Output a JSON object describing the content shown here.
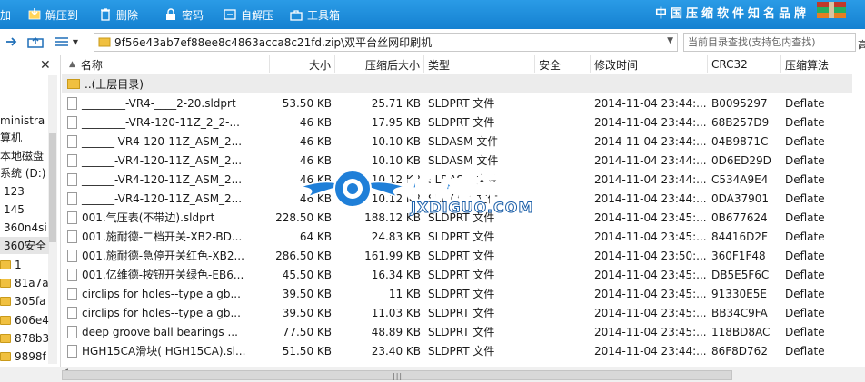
{
  "toolbar": {
    "items": [
      {
        "label": "加",
        "icon": "add-icon"
      },
      {
        "label": "解压到",
        "icon": "extract-to-icon"
      },
      {
        "label": "删除",
        "icon": "delete-icon"
      },
      {
        "label": "密码",
        "icon": "password-icon"
      },
      {
        "label": "自解压",
        "icon": "self-extract-icon"
      },
      {
        "label": "工具箱",
        "icon": "toolbox-icon"
      }
    ],
    "brand": "中国压缩软件知名品牌",
    "colors": {
      "background": "#1a8ad9",
      "text": "#ffffff"
    }
  },
  "address": {
    "path": "9f56e43ab7ef88ee8c4863acca8c21fd.zip\\双平台丝网印刷机",
    "search_placeholder": "当前目录查找(支持包内查找)",
    "search_button": "高"
  },
  "tree": {
    "items": [
      {
        "label": "ministra",
        "folder": false
      },
      {
        "label": "算机",
        "folder": false
      },
      {
        "label": "本地磁盘",
        "folder": false
      },
      {
        "label": "系统 (D:)",
        "folder": false
      },
      {
        "label": "123",
        "folder": false
      },
      {
        "label": "145",
        "folder": false
      },
      {
        "label": "360n4si",
        "folder": false
      },
      {
        "label": "360安全",
        "folder": false
      },
      {
        "label": "1",
        "folder": true
      },
      {
        "label": "81a7a",
        "folder": true
      },
      {
        "label": "305fa",
        "folder": true
      },
      {
        "label": "606e4",
        "folder": true
      },
      {
        "label": "878b3",
        "folder": true
      },
      {
        "label": "9898f",
        "folder": true
      }
    ]
  },
  "columns": [
    "名称",
    "大小",
    "压缩后大小",
    "类型",
    "安全",
    "修改时间",
    "CRC32",
    "压缩算法"
  ],
  "parent_row": {
    "label": "..(上层目录)"
  },
  "files": [
    {
      "name": "________-VR4-____2-20.sldprt",
      "size": "53.50 KB",
      "packed": "25.71 KB",
      "type": "SLDPRT 文件",
      "time": "2014-11-04 23:44:...",
      "crc": "B0095297",
      "method": "Deflate"
    },
    {
      "name": "________-VR4-120-11Z_2_2-...",
      "size": "46 KB",
      "packed": "17.95 KB",
      "type": "SLDPRT 文件",
      "time": "2014-11-04 23:44:...",
      "crc": "68B257D9",
      "method": "Deflate"
    },
    {
      "name": "______-VR4-120-11Z_ASM_2...",
      "size": "46 KB",
      "packed": "10.10 KB",
      "type": "SLDASM 文件",
      "time": "2014-11-04 23:44:...",
      "crc": "04B9871C",
      "method": "Deflate"
    },
    {
      "name": "______-VR4-120-11Z_ASM_2...",
      "size": "46 KB",
      "packed": "10.10 KB",
      "type": "SLDASM 文件",
      "time": "2014-11-04 23:44:...",
      "crc": "0D6ED29D",
      "method": "Deflate"
    },
    {
      "name": "______-VR4-120-11Z_ASM_2...",
      "size": "46 KB",
      "packed": "10.12 KB",
      "type": "SLDASM 文件",
      "time": "2014-11-04 23:44:...",
      "crc": "C534A9E4",
      "method": "Deflate"
    },
    {
      "name": "______-VR4-120-11Z_ASM_2...",
      "size": "46 KB",
      "packed": "10.12 KB",
      "type": "SLDASM 文件",
      "time": "2014-11-04 23:44:...",
      "crc": "0DA37901",
      "method": "Deflate"
    },
    {
      "name": "001.气压表(不带边).sldprt",
      "size": "228.50 KB",
      "packed": "188.12 KB",
      "type": "SLDPRT 文件",
      "time": "2014-11-04 23:45:...",
      "crc": "0B677624",
      "method": "Deflate"
    },
    {
      "name": "001.施耐德-二档开关-XB2-BD...",
      "size": "64 KB",
      "packed": "24.83 KB",
      "type": "SLDPRT 文件",
      "time": "2014-11-04 23:45:...",
      "crc": "84416D2F",
      "method": "Deflate"
    },
    {
      "name": "001.施耐德-急停开关红色-XB2...",
      "size": "286.50 KB",
      "packed": "161.99 KB",
      "type": "SLDPRT 文件",
      "time": "2014-11-04 23:50:...",
      "crc": "360F1F48",
      "method": "Deflate"
    },
    {
      "name": "001.亿维德-按钮开关绿色-EB6...",
      "size": "45.50 KB",
      "packed": "16.34 KB",
      "type": "SLDPRT 文件",
      "time": "2014-11-04 23:45:...",
      "crc": "DB5E5F6C",
      "method": "Deflate"
    },
    {
      "name": "circlips for holes--type a gb...",
      "size": "39.50 KB",
      "packed": "11 KB",
      "type": "SLDPRT 文件",
      "time": "2014-11-04 23:45:...",
      "crc": "91330E5E",
      "method": "Deflate"
    },
    {
      "name": "circlips for holes--type a gb...",
      "size": "39.50 KB",
      "packed": "11.03 KB",
      "type": "SLDPRT 文件",
      "time": "2014-11-04 23:45:...",
      "crc": "BB34C9FA",
      "method": "Deflate"
    },
    {
      "name": "deep groove ball bearings ...",
      "size": "77.50 KB",
      "packed": "48.89 KB",
      "type": "SLDPRT 文件",
      "time": "2014-11-04 23:45:...",
      "crc": "118BD8AC",
      "method": "Deflate"
    },
    {
      "name": "HGH15CA滑块( HGH15CA).sl...",
      "size": "51.50 KB",
      "packed": "23.40 KB",
      "type": "SLDPRT 文件",
      "time": "2014-11-04 23:44:...",
      "crc": "86F8D762",
      "method": "Deflate"
    }
  ],
  "watermark": {
    "title": "机械帝国",
    "subtitle": "JXDIGUO.COM",
    "colors": {
      "primary": "#1f7fd8"
    }
  }
}
